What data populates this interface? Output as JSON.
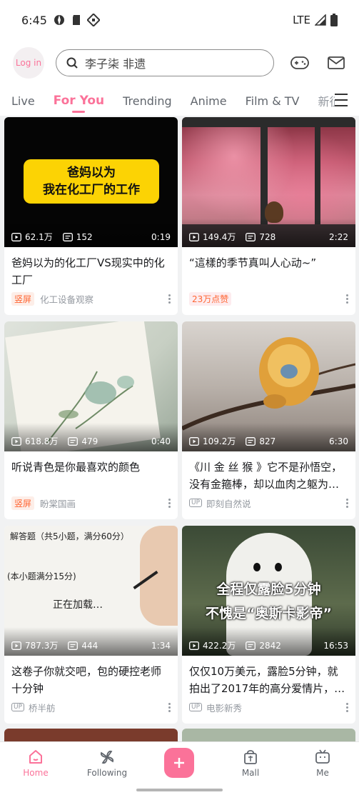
{
  "status_bar": {
    "time": "6:45",
    "network": "LTE"
  },
  "header": {
    "login_label": "Log in",
    "search_placeholder": "李子柒 非遗"
  },
  "tabs": [
    "Live",
    "For You",
    "Trending",
    "Anime",
    "Film & TV",
    "新征"
  ],
  "active_tab": "For You",
  "cards": [
    {
      "thumb_text_line1": "爸妈以为",
      "thumb_text_line2": "我在化工厂的工作",
      "views": "62.1万",
      "danmaku": "152",
      "duration": "0:19",
      "title": "爸妈以为的化工厂VS现实中的化工厂",
      "tag": "竖屏",
      "author": "化工设备观察",
      "author_up": false
    },
    {
      "views": "149.4万",
      "danmaku": "728",
      "duration": "2:22",
      "title": "“這樣的季节真叫人心动~”",
      "tag": "23万点赞",
      "author": "",
      "author_up": false
    },
    {
      "views": "618.8万",
      "danmaku": "479",
      "duration": "0:40",
      "title": "听说青色是你最喜欢的颜色",
      "tag": "竖屏",
      "author": "盼棠国画",
      "author_up": false
    },
    {
      "views": "109.2万",
      "danmaku": "827",
      "duration": "6:30",
      "title": "《川 金 丝 猴 》它不是孙悟空，没有金箍棒，却以血肉之躯为…",
      "tag": "",
      "author": "即刻自然说",
      "author_up": true
    },
    {
      "thumb_text_line1": "解答题（共5小题，满分60分）",
      "thumb_text_line2": "(本小题满分15分)",
      "thumb_text_line3": "正在加载…",
      "views": "787.3万",
      "danmaku": "444",
      "duration": "1:34",
      "title": "这卷子你就交吧，包的硬控老师十分钟",
      "tag": "",
      "author": "桥半舫",
      "author_up": true
    },
    {
      "thumb_text_line1": "全程仅露脸5分钟",
      "thumb_text_line2": "不愧是“奥斯卡影帝”",
      "views": "422.2万",
      "danmaku": "2842",
      "duration": "16:53",
      "title": "仅仅10万美元，露脸5分钟，就拍出了2017年的高分爱情片，…",
      "tag": "",
      "author": "电影新秀",
      "author_up": true
    }
  ],
  "bottom_nav": {
    "home": "Home",
    "following": "Following",
    "mall": "Mall",
    "me": "Me"
  },
  "colors": {
    "accent": "#fb7299",
    "tag_text": "#ff6633"
  }
}
